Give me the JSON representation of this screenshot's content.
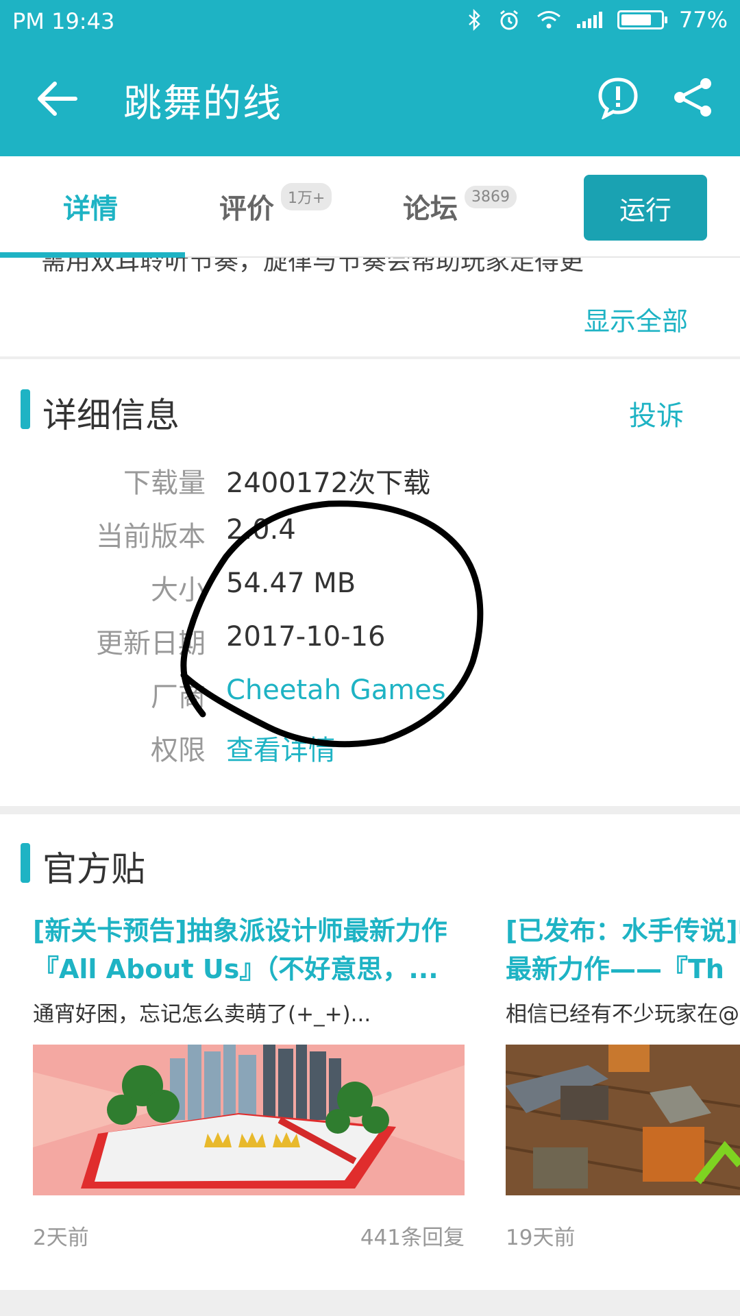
{
  "status_bar": {
    "time": "PM 19:43",
    "battery": "77%",
    "battery_level": 0.77,
    "icons": [
      "bluetooth-icon",
      "alarm-icon",
      "wifi-icon",
      "signal-icon",
      "battery-icon"
    ]
  },
  "app_bar": {
    "title": "跳舞的线",
    "icons": [
      "back-arrow-icon",
      "report-icon",
      "share-icon"
    ]
  },
  "tabs": [
    {
      "label": "详情",
      "count": "",
      "active": true
    },
    {
      "label": "评价",
      "count": "1万+",
      "active": false
    },
    {
      "label": "论坛",
      "count": "3869",
      "active": false
    }
  ],
  "run_button": "运行",
  "description": {
    "partial_text": "需用双耳聆听节奏，旋律与节奏会帮助玩家走得更",
    "show_all": "显示全部"
  },
  "details": {
    "title": "详细信息",
    "complain": "投诉",
    "rows": [
      {
        "label": "下载量",
        "value": "2400172次下载",
        "link": false
      },
      {
        "label": "当前版本",
        "value": "2.0.4",
        "link": false
      },
      {
        "label": "大小",
        "value": "54.47 MB",
        "link": false
      },
      {
        "label": "更新日期",
        "value": "2017-10-16",
        "link": false
      },
      {
        "label": "厂商",
        "value": "Cheetah Games",
        "link": true
      },
      {
        "label": "权限",
        "value": "查看详情",
        "link": true
      }
    ]
  },
  "official": {
    "title": "官方贴",
    "posts": [
      {
        "title": "[新关卡预告]抽象派设计师最新力作『All About Us』（不好意思，...",
        "summary": "通宵好困，忘记怎么卖萌了(+_+)...",
        "time": "2天前",
        "replies": "441条回复"
      },
      {
        "title": "[已发布：水手传说]师最新力作——『Th",
        "summary": "相信已经有不少玩家在@",
        "time": "19天前",
        "replies": ""
      }
    ]
  },
  "colors": {
    "accent": "#1eb3c4",
    "run_button": "#1aa2b2",
    "label_gray": "#999999",
    "annotation": "#000000"
  }
}
